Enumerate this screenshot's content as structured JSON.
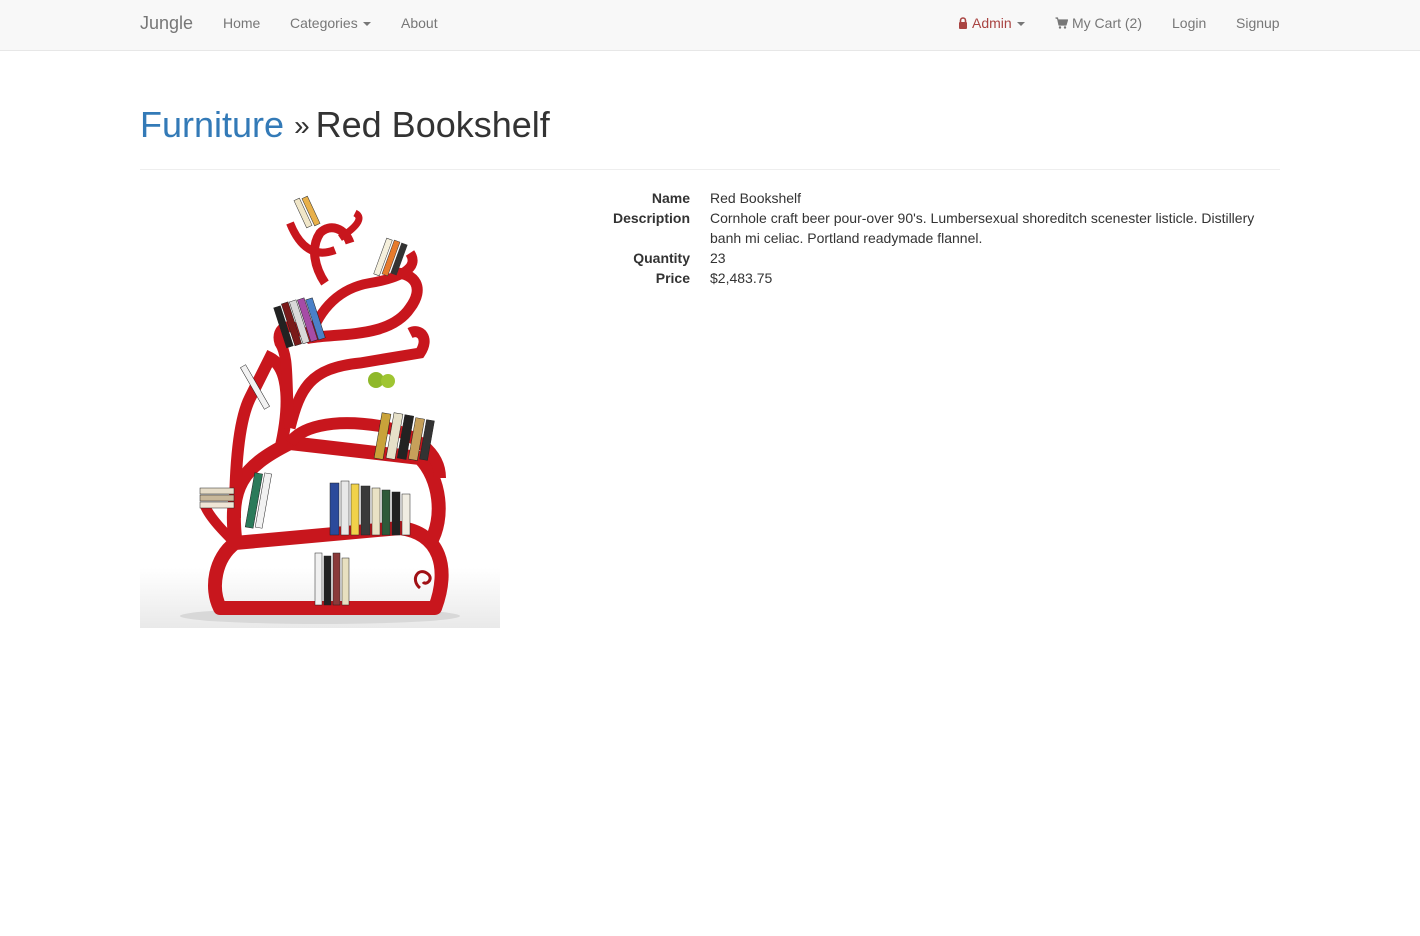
{
  "nav": {
    "brand": "Jungle",
    "home": "Home",
    "categories": "Categories",
    "about": "About",
    "admin": "Admin",
    "cart": "My Cart (2)",
    "login": "Login",
    "signup": "Signup",
    "admin_color": "#a94442"
  },
  "header": {
    "category": "Furniture",
    "separator": "»",
    "product": "Red Bookshelf"
  },
  "product": {
    "image_alt": "Red Bookshelf",
    "labels": {
      "name": "Name",
      "description": "Description",
      "quantity": "Quantity",
      "price": "Price"
    },
    "name": "Red Bookshelf",
    "description": "Cornhole craft beer pour-over 90's. Lumbersexual shoreditch scenester listicle. Distillery banh mi celiac. Portland readymade flannel.",
    "quantity": "23",
    "price": "$2,483.75",
    "accent": "#c8161d"
  }
}
